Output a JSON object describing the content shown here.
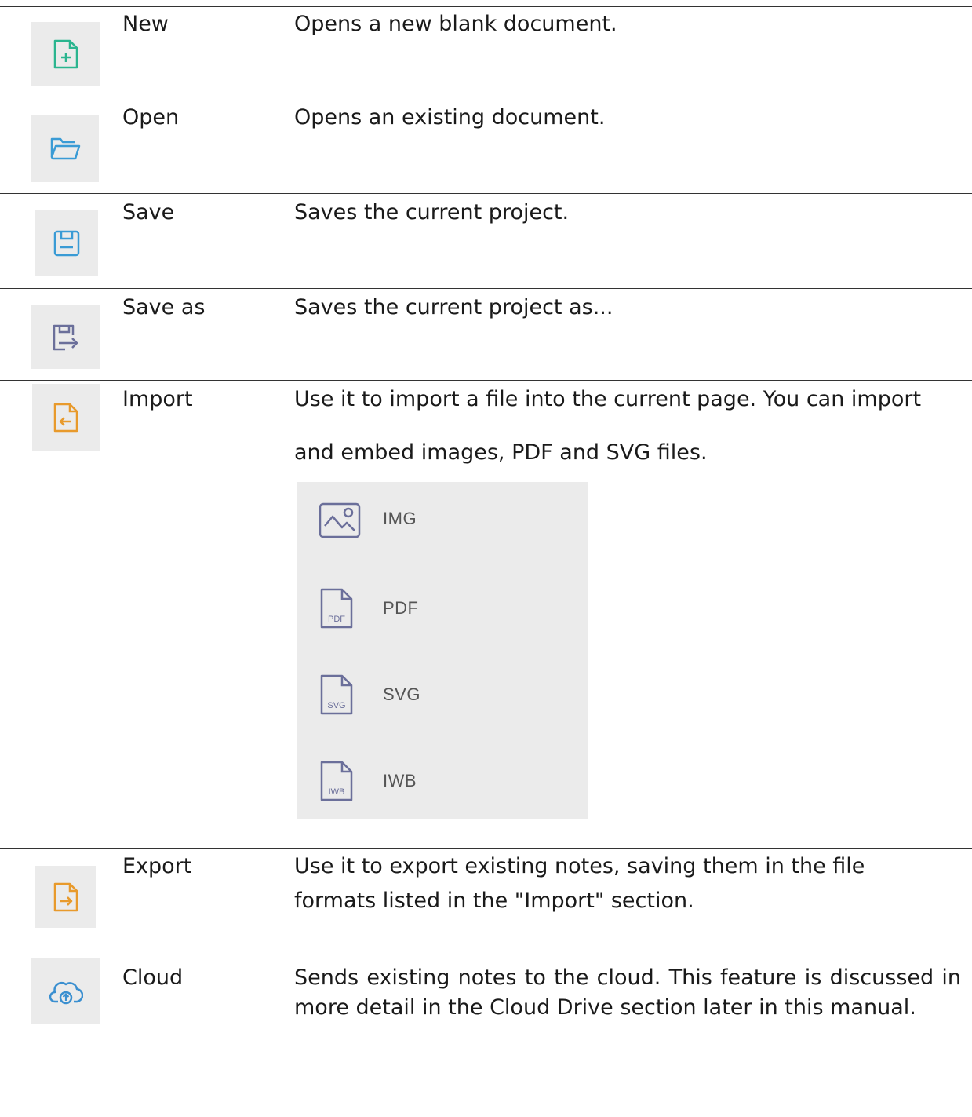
{
  "rows": [
    {
      "icon": "new-file-icon",
      "name": "New",
      "description": "Opens a new blank document."
    },
    {
      "icon": "folder-open-icon",
      "name": "Open",
      "description": "Opens an existing document."
    },
    {
      "icon": "save-icon",
      "name": "Save",
      "description": "Saves the current project."
    },
    {
      "icon": "save-as-icon",
      "name": "Save as",
      "description": "Saves the current project as..."
    },
    {
      "icon": "import-icon",
      "name": "Import",
      "description_line1": "Use it to import a file into the current page. You can import",
      "description_line2": "and embed images, PDF and SVG files.",
      "submenu": [
        {
          "icon": "image-icon",
          "label": "IMG"
        },
        {
          "icon": "pdf-file-icon",
          "label": "PDF",
          "badge": "PDF"
        },
        {
          "icon": "svg-file-icon",
          "label": "SVG",
          "badge": "SVG"
        },
        {
          "icon": "iwb-file-icon",
          "label": "IWB",
          "badge": "IWB"
        }
      ]
    },
    {
      "icon": "export-icon",
      "name": "Export",
      "description_line1": "Use it to export existing notes, saving them in the file",
      "description_line2": "formats listed in the \"Import\" section."
    },
    {
      "icon": "cloud-upload-icon",
      "name": "Cloud",
      "description": "Sends existing notes to the cloud. This feature is discussed in more detail in the Cloud Drive section later in this manual."
    }
  ],
  "colors": {
    "new": "#2bb58f",
    "open": "#3a9bd5",
    "save": "#3a9bd5",
    "save_as": "#6b6f9a",
    "import": "#e89a2c",
    "export": "#e89a2c",
    "cloud": "#3a8fd0"
  }
}
